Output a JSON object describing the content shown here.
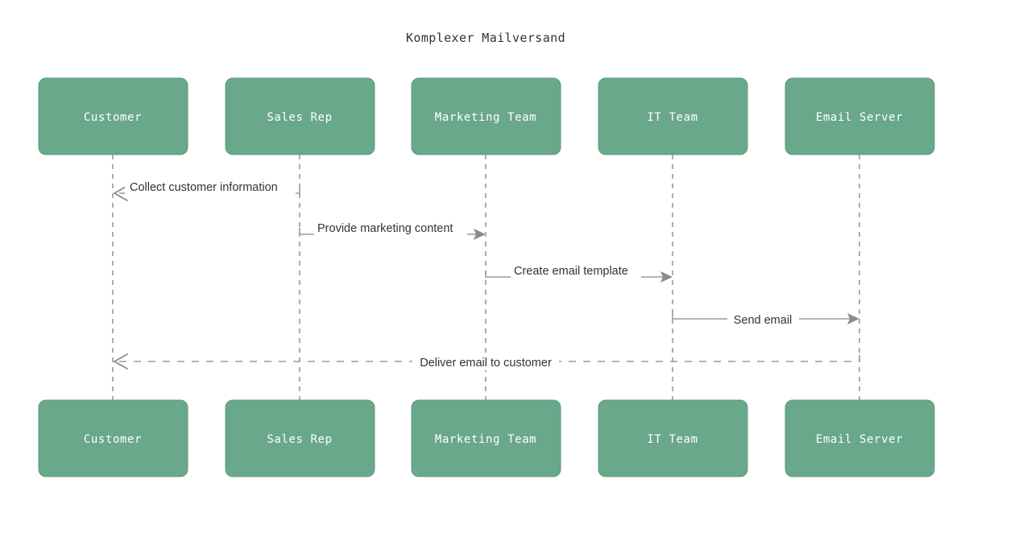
{
  "diagram": {
    "title": "Komplexer Mailversand",
    "type": "sequence-diagram",
    "colors": {
      "actor_fill": "#69a88a",
      "actor_stroke": "#5f9c7f",
      "actor_text": "#ffffff",
      "lifeline": "#999999",
      "message_line": "#9a9aa3",
      "message_text": "#333333",
      "background": "#ffffff"
    },
    "actors": [
      {
        "id": "customer",
        "label": "Customer"
      },
      {
        "id": "sales-rep",
        "label": "Sales Rep"
      },
      {
        "id": "marketing-team",
        "label": "Marketing Team"
      },
      {
        "id": "it-team",
        "label": "IT Team"
      },
      {
        "id": "email-server",
        "label": "Email Server"
      }
    ],
    "messages": [
      {
        "index": 1,
        "label": "Collect customer information",
        "from": "sales-rep",
        "to": "customer",
        "style": "solid",
        "direction": "left"
      },
      {
        "index": 2,
        "label": "Provide marketing content",
        "from": "sales-rep",
        "to": "marketing-team",
        "style": "solid",
        "direction": "right"
      },
      {
        "index": 3,
        "label": "Create email template",
        "from": "marketing-team",
        "to": "it-team",
        "style": "solid",
        "direction": "right"
      },
      {
        "index": 4,
        "label": "Send email",
        "from": "it-team",
        "to": "email-server",
        "style": "solid",
        "direction": "right"
      },
      {
        "index": 5,
        "label": "Deliver email to customer",
        "from": "email-server",
        "to": "customer",
        "style": "dashed",
        "direction": "left"
      }
    ]
  }
}
